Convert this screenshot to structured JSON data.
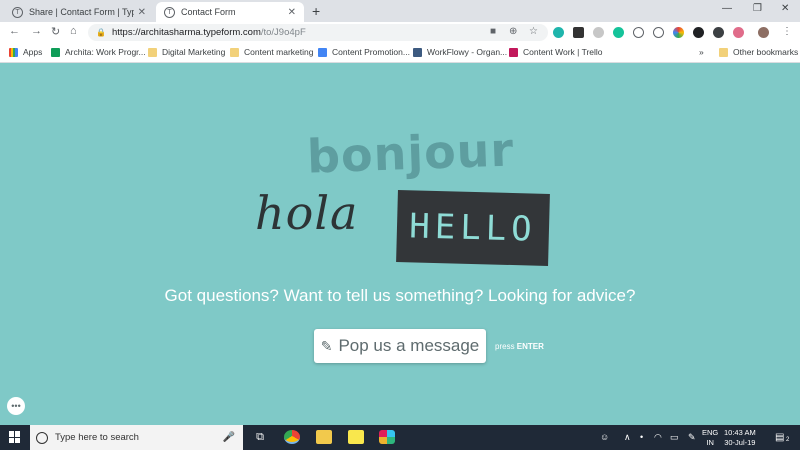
{
  "browser": {
    "tabs": [
      {
        "label": "Share | Contact Form | Typeform",
        "favicon": "T",
        "active": false
      },
      {
        "label": "Contact Form",
        "favicon": "T",
        "active": true
      }
    ],
    "new_tab": "+",
    "url_host": "https://architasharma.typeform.com",
    "url_path": "/to/J9o4pF"
  },
  "bookmarks": {
    "apps": "Apps",
    "items": [
      {
        "label": "Archita: Work Progr...",
        "icon": "sheets-icon",
        "color": "#0f9d58"
      },
      {
        "label": "Digital Marketing",
        "icon": "folder-icon",
        "color": "#f2d17a"
      },
      {
        "label": "Content marketing",
        "icon": "folder-icon",
        "color": "#f2d17a"
      },
      {
        "label": "Content Promotion...",
        "icon": "docs-icon",
        "color": "#4285f4"
      },
      {
        "label": "WorkFlowy - Organ...",
        "icon": "workflowy-icon",
        "color": "#3d5a80"
      },
      {
        "label": "Content Work | Trello",
        "icon": "trello-icon",
        "color": "#c2185b"
      }
    ],
    "more": "»",
    "other": "Other bookmarks"
  },
  "page": {
    "bonjour": "bonjour",
    "hola": "hola",
    "hello": "HELLO",
    "question": "Got questions? Want to tell us something? Looking for advice?",
    "cta_label": "Pop us a message",
    "hint_prefix": "press",
    "hint_key": "ENTER",
    "background": "#7fc9c7"
  },
  "taskbar": {
    "search_placeholder": "Type here to search",
    "lang_line1": "ENG",
    "lang_line2": "IN",
    "time": "10:43 AM",
    "date": "30-Jul-19",
    "notification_count": "2"
  }
}
